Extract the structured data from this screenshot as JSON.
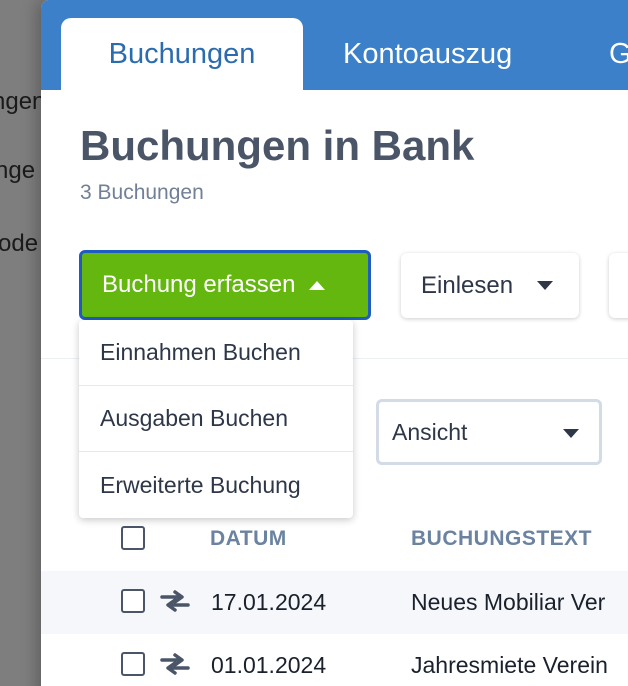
{
  "background": {
    "sidebar_fragments": [
      "ngen",
      "nge",
      "ode"
    ]
  },
  "tabs": [
    {
      "label": "Buchungen",
      "active": true
    },
    {
      "label": "Kontoauszug",
      "active": false
    },
    {
      "label": "G",
      "active": false
    }
  ],
  "page": {
    "title": "Buchungen in Bank",
    "subtitle": "3 Buchungen"
  },
  "toolbar": {
    "primary_label": "Buchung erfassen",
    "import_label": "Einlesen"
  },
  "dropdown": {
    "items": [
      "Einnahmen Buchen",
      "Ausgaben Buchen",
      "Erweiterte Buchung"
    ]
  },
  "view_select": {
    "value": "Ansicht"
  },
  "table": {
    "columns": [
      "DATUM",
      "BUCHUNGSTEXT"
    ],
    "rows": [
      {
        "date": "17.01.2024",
        "text": "Neues Mobiliar Ver"
      },
      {
        "date": "01.01.2024",
        "text": "Jahresmiete Verein"
      }
    ]
  },
  "colors": {
    "tabbar": "#3b80c9",
    "primary_button": "#63b70f",
    "focus_border": "#1f5cbf",
    "title": "#4a5568",
    "header_text": "#6b83a0"
  }
}
